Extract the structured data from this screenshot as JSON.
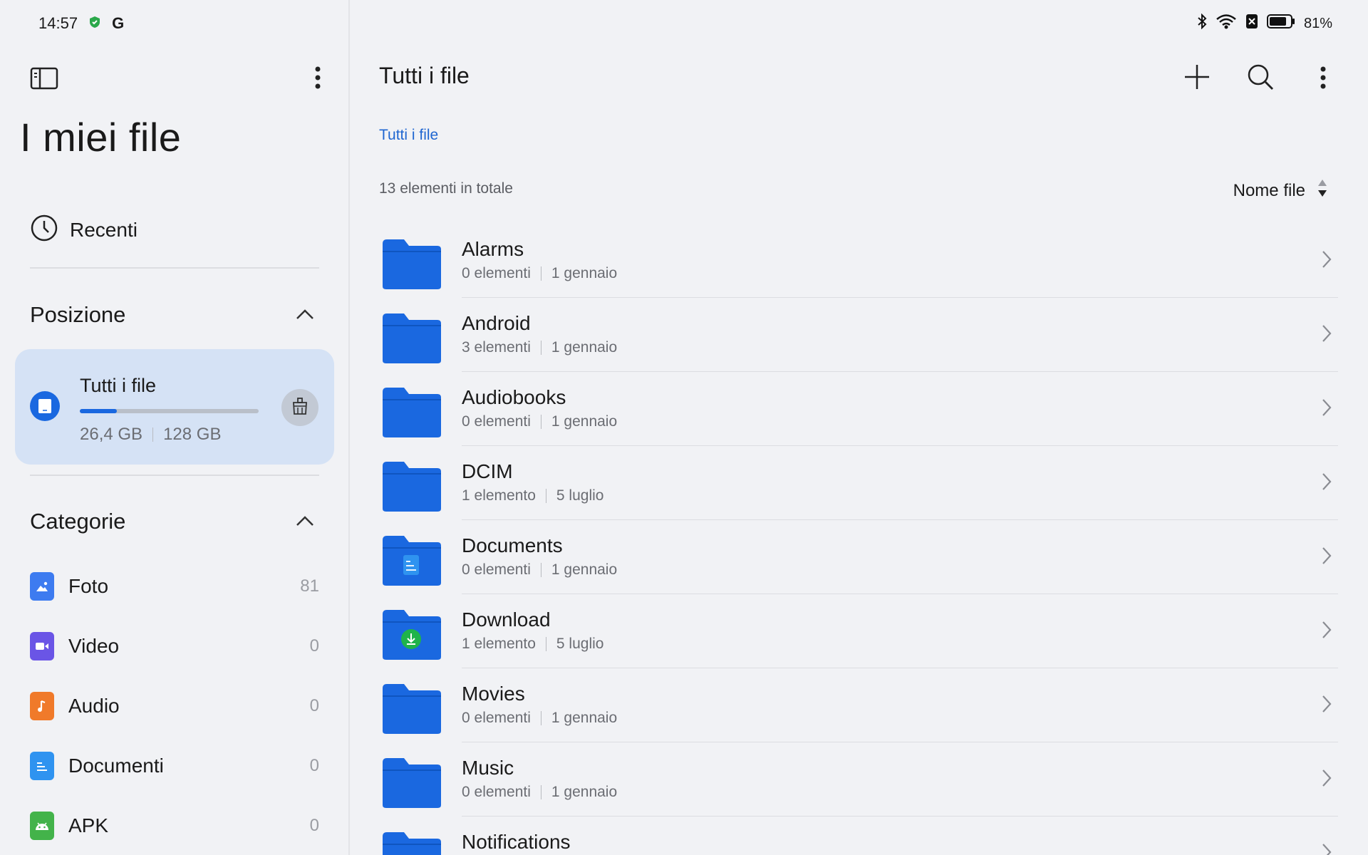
{
  "status": {
    "time": "14:57",
    "g_letter": "G",
    "battery": "81%"
  },
  "sidebar": {
    "title": "I miei file",
    "recent_label": "Recenti",
    "position_title": "Posizione",
    "storage": {
      "name": "Tutti i file",
      "used": "26,4 GB",
      "total": "128 GB",
      "fill_percent": 20.6
    },
    "categories_title": "Categorie",
    "categories": [
      {
        "label": "Foto",
        "count": "81",
        "color": "#3d7bf0"
      },
      {
        "label": "Video",
        "count": "0",
        "color": "#6a55e6"
      },
      {
        "label": "Audio",
        "count": "0",
        "color": "#f07a2a"
      },
      {
        "label": "Documenti",
        "count": "0",
        "color": "#2f93f0"
      },
      {
        "label": "APK",
        "count": "0",
        "color": "#43b34a"
      }
    ]
  },
  "main": {
    "title": "Tutti i file",
    "breadcrumb": "Tutti i file",
    "total": "13 elementi in totale",
    "sort_label": "Nome file",
    "files": [
      {
        "name": "Alarms",
        "items": "0 elementi",
        "date": "1 gennaio",
        "badge": ""
      },
      {
        "name": "Android",
        "items": "3 elementi",
        "date": "1 gennaio",
        "badge": ""
      },
      {
        "name": "Audiobooks",
        "items": "0 elementi",
        "date": "1 gennaio",
        "badge": ""
      },
      {
        "name": "DCIM",
        "items": "1 elemento",
        "date": "5 luglio",
        "badge": ""
      },
      {
        "name": "Documents",
        "items": "0 elementi",
        "date": "1 gennaio",
        "badge": "doc"
      },
      {
        "name": "Download",
        "items": "1 elemento",
        "date": "5 luglio",
        "badge": "download"
      },
      {
        "name": "Movies",
        "items": "0 elementi",
        "date": "1 gennaio",
        "badge": ""
      },
      {
        "name": "Music",
        "items": "0 elementi",
        "date": "1 gennaio",
        "badge": ""
      },
      {
        "name": "Notifications",
        "items": "",
        "date": "",
        "badge": ""
      }
    ]
  },
  "colors": {
    "accent": "#1f66d1",
    "folder": "#1a68e0",
    "card": "#d5e2f5"
  }
}
